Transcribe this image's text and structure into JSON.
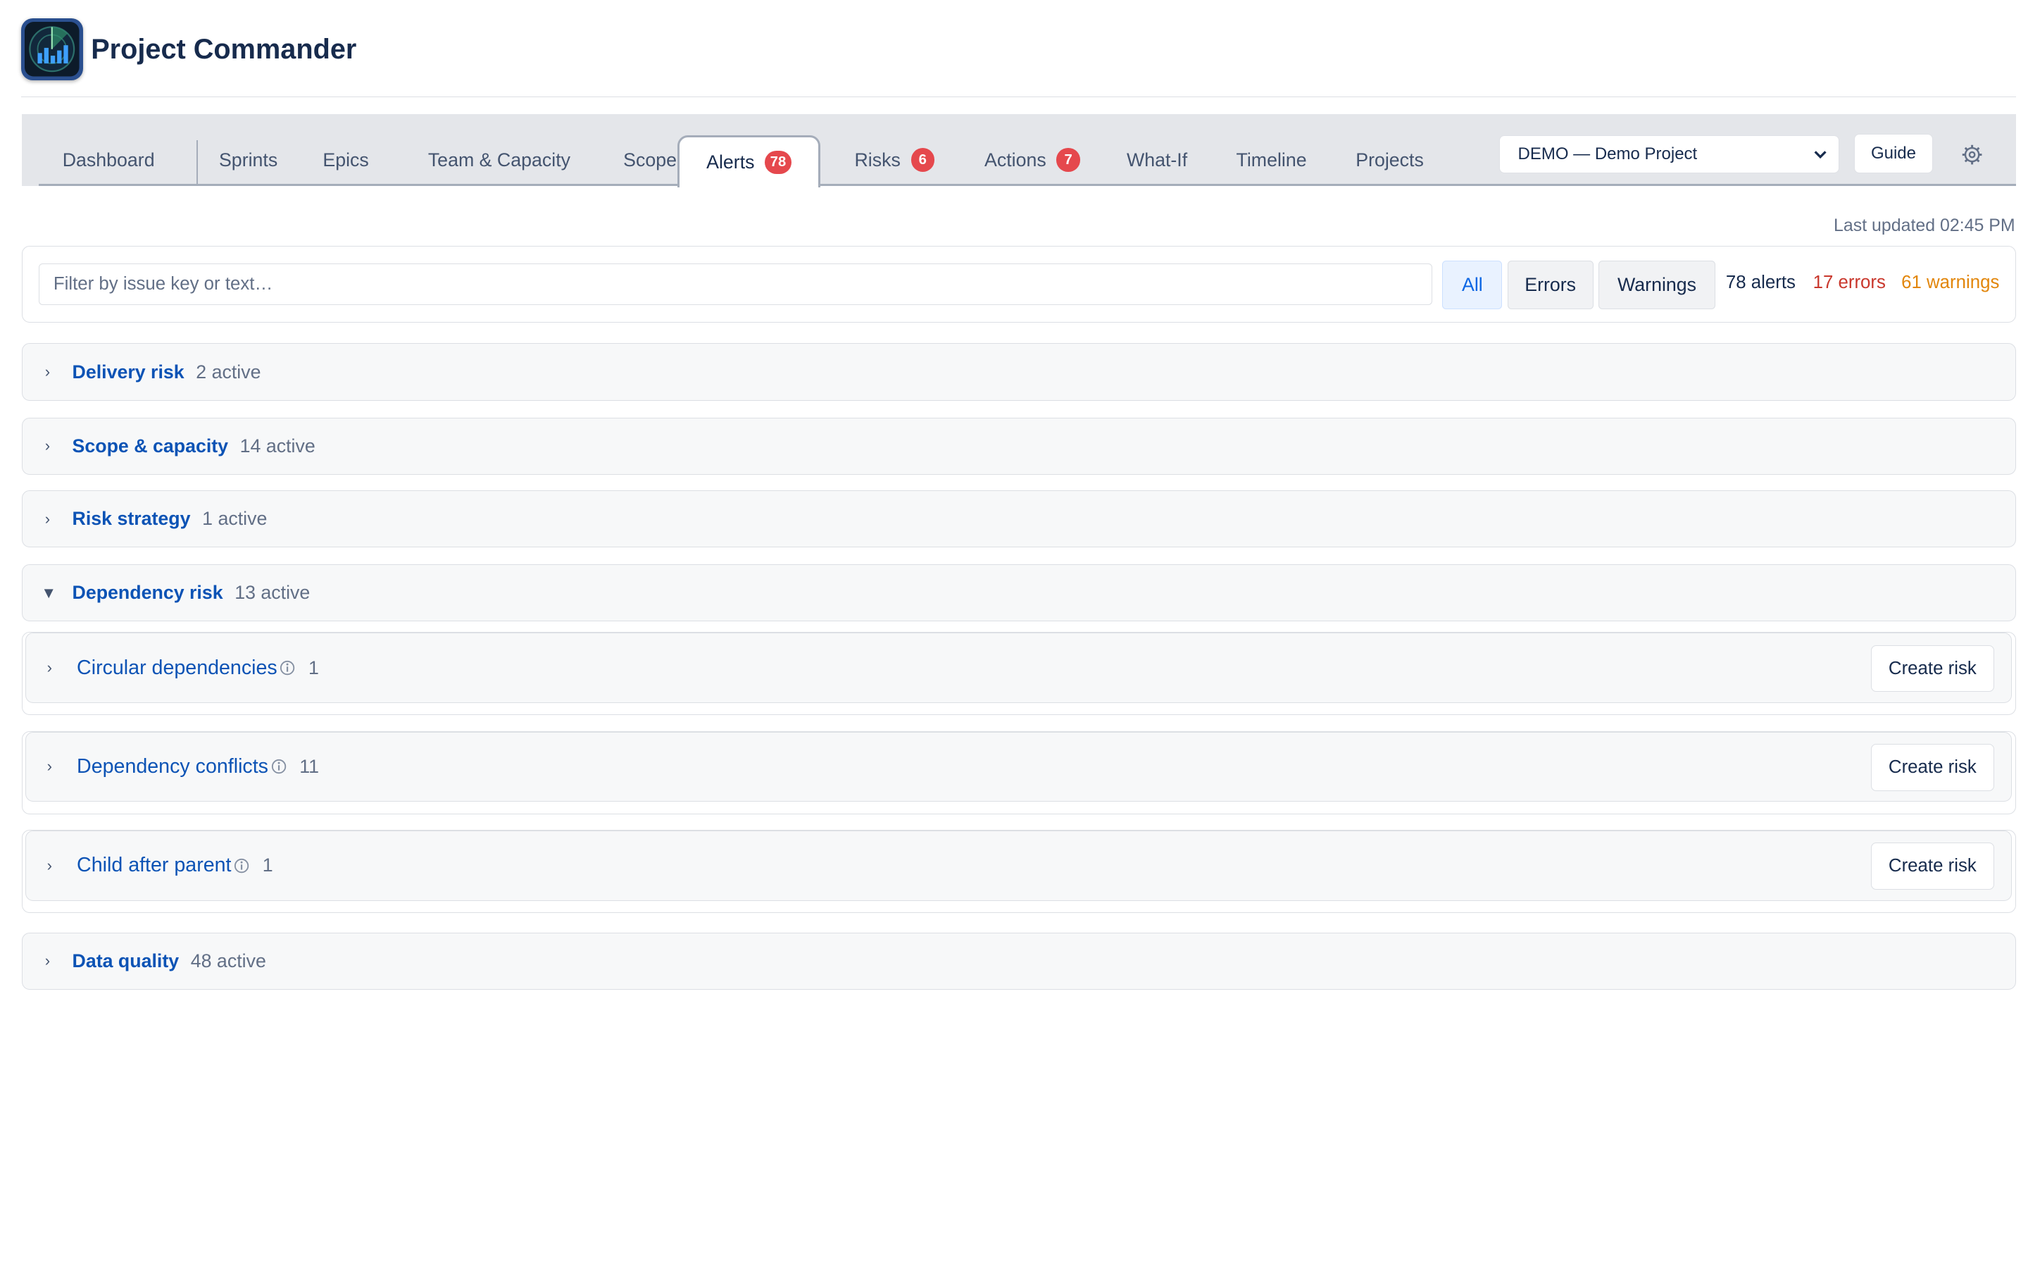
{
  "app": {
    "title": "Project Commander"
  },
  "tabs": [
    {
      "label": "Dashboard"
    },
    {
      "label": "Sprints"
    },
    {
      "label": "Epics"
    },
    {
      "label": "Team & Capacity"
    },
    {
      "label": "Scope"
    },
    {
      "label": "Alerts",
      "badge": "78",
      "active": true
    },
    {
      "label": "Risks",
      "badge": "6"
    },
    {
      "label": "Actions",
      "badge": "7"
    },
    {
      "label": "What-If"
    },
    {
      "label": "Timeline"
    },
    {
      "label": "Projects"
    }
  ],
  "project_select": {
    "value": "DEMO — Demo Project",
    "icon": "chevron-down-icon"
  },
  "guide_label": "Guide",
  "settings_icon": "gear-icon",
  "last_updated": "Last updated 02:45 PM",
  "filter": {
    "placeholder": "Filter by issue key or text…",
    "segments": [
      "All",
      "Errors",
      "Warnings"
    ],
    "active_segment": "All",
    "total": "78 alerts",
    "errors": "17 errors",
    "warnings": "61 warnings"
  },
  "categories": [
    {
      "title": "Delivery risk",
      "count": "2 active",
      "expanded": false
    },
    {
      "title": "Scope & capacity",
      "count": "14 active",
      "expanded": false
    },
    {
      "title": "Risk strategy",
      "count": "1 active",
      "expanded": false
    },
    {
      "title": "Dependency risk",
      "count": "13 active",
      "expanded": true
    },
    {
      "title": "Data quality",
      "count": "48 active",
      "expanded": false
    }
  ],
  "dependency_subgroups": [
    {
      "title": "Circular dependencies",
      "count": "1",
      "action": "Create risk"
    },
    {
      "title": "Dependency conflicts",
      "count": "11",
      "action": "Create risk"
    },
    {
      "title": "Child after parent",
      "count": "1",
      "action": "Create risk"
    }
  ],
  "colors": {
    "link": "#0c53b5",
    "badge": "#e5484d",
    "error": "#c9372c",
    "warning": "#e2860b",
    "active_segment": "#0c66e4"
  }
}
